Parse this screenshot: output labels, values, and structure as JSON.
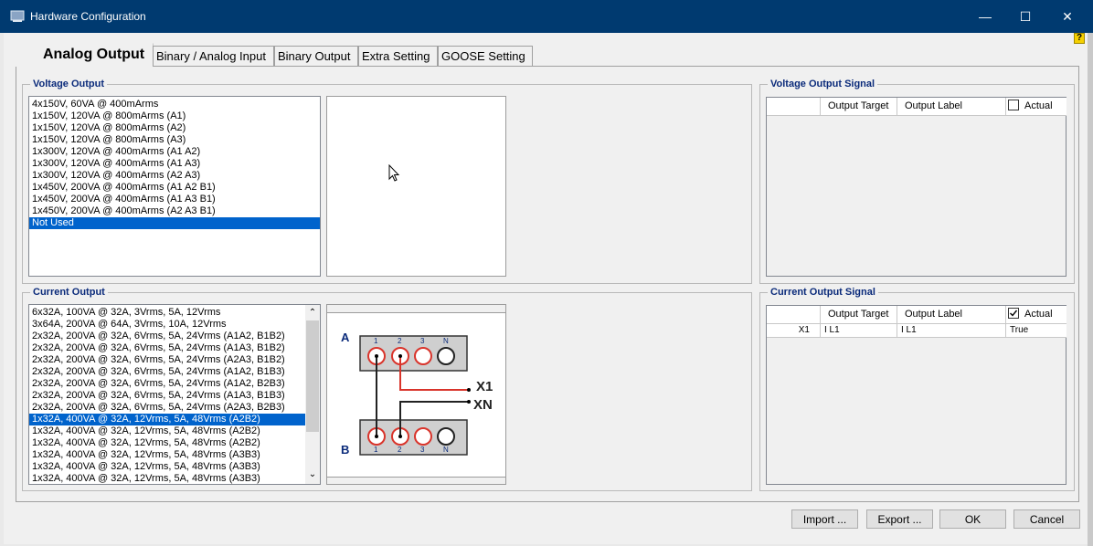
{
  "window": {
    "title": "Hardware Configuration",
    "minimize_glyph": "—",
    "maximize_glyph": "☐",
    "close_glyph": "✕",
    "help_glyph": "?"
  },
  "tabs": [
    "Analog Output",
    "Binary / Analog Input",
    "Binary Output",
    "Extra Setting",
    "GOOSE Setting"
  ],
  "voltage_output": {
    "title": "Voltage Output",
    "items": [
      "4x150V,  60VA @ 400mArms",
      "1x150V, 120VA @ 800mArms (A1)",
      "1x150V, 120VA @ 800mArms (A2)",
      "1x150V, 120VA @ 800mArms (A3)",
      "1x300V, 120VA @ 400mArms (A1 A2)",
      "1x300V, 120VA @ 400mArms (A1 A3)",
      "1x300V, 120VA @ 400mArms (A2 A3)",
      "1x450V, 200VA @ 400mArms (A1 A2 B1)",
      "1x450V, 200VA @ 400mArms (A1 A3 B1)",
      "1x450V, 200VA @ 400mArms (A2 A3 B1)",
      "Not Used"
    ],
    "selected_index": 10
  },
  "current_output": {
    "title": "Current Output",
    "items": [
      "6x32A, 100VA @ 32A, 3Vrms, 5A, 12Vrms",
      "3x64A, 200VA @ 64A, 3Vrms, 10A, 12Vrms",
      "2x32A, 200VA @ 32A, 6Vrms, 5A, 24Vrms (A1A2, B1B2)",
      "2x32A, 200VA @ 32A, 6Vrms, 5A, 24Vrms (A1A3, B1B2)",
      "2x32A, 200VA @ 32A, 6Vrms, 5A, 24Vrms (A2A3, B1B2)",
      "2x32A, 200VA @ 32A, 6Vrms, 5A, 24Vrms (A1A2, B1B3)",
      "2x32A, 200VA @ 32A, 6Vrms, 5A, 24Vrms (A1A2, B2B3)",
      "2x32A, 200VA @ 32A, 6Vrms, 5A, 24Vrms (A1A3, B1B3)",
      "2x32A, 200VA @ 32A, 6Vrms, 5A, 24Vrms (A2A3, B2B3)",
      "1x32A, 400VA @ 32A, 12Vrms, 5A, 48Vrms (A2B2)",
      "1x32A, 400VA @ 32A, 12Vrms, 5A, 48Vrms (A2B2)",
      "1x32A, 400VA @ 32A, 12Vrms, 5A, 48Vrms (A2B2)",
      "1x32A, 400VA @ 32A, 12Vrms, 5A, 48Vrms (A3B3)",
      "1x32A, 400VA @ 32A, 12Vrms, 5A, 48Vrms (A3B3)",
      "1x32A, 400VA @ 32A, 12Vrms, 5A, 48Vrms (A3B3)"
    ],
    "selected_index": 9,
    "scroll_up_glyph": "⌃",
    "scroll_down_glyph": "⌄"
  },
  "wiring_diagram": {
    "group_a_label": "A",
    "group_b_label": "B",
    "terminal_labels": [
      "1",
      "2",
      "3",
      "N"
    ],
    "x1_label": "X1",
    "xn_label": "XN"
  },
  "voltage_signal": {
    "title": "Voltage Output Signal",
    "col_target": "Output Target",
    "col_label": "Output Label",
    "col_actual": "Actual",
    "actual_checked": false
  },
  "current_signal": {
    "title": "Current Output Signal",
    "col_target": "Output Target",
    "col_label": "Output Label",
    "col_actual": "Actual",
    "actual_checked": true,
    "rows": [
      {
        "name": "X1",
        "target": "I L1",
        "label": "I L1",
        "actual": "True"
      }
    ]
  },
  "buttons": {
    "import": "Import ...",
    "export": "Export ...",
    "ok": "OK",
    "cancel": "Cancel"
  },
  "colors": {
    "titlebar": "#003a70",
    "selection": "#0063cc",
    "group_title": "#0a2a7a",
    "wire_red": "#d9342b"
  }
}
